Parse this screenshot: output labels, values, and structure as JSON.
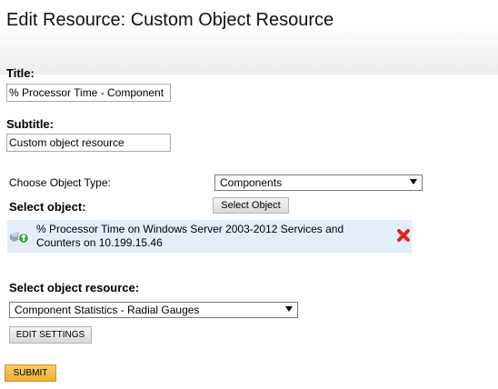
{
  "page": {
    "title": "Edit Resource: Custom Object Resource"
  },
  "form": {
    "title_label": "Title:",
    "title_value": "% Processor Time - Component",
    "subtitle_label": "Subtitle:",
    "subtitle_value": "Custom object resource",
    "object_type_label": "Choose Object Type:",
    "object_type_value": "Components",
    "select_object_label": "Select object:",
    "select_object_button": "Select Object",
    "selected_object": {
      "name": "% Processor Time on Windows Server 2003-2012 Services and Counters on 10.199.15.46",
      "icon": "component-status-up-icon",
      "remove_icon": "red-x-remove-icon"
    },
    "object_resource_label": "Select object resource:",
    "object_resource_value": "Component Statistics - Radial Gauges",
    "edit_settings_button": "EDIT SETTINGS",
    "submit_button": "SUBMIT"
  },
  "colors": {
    "selected_row_bg": "#e3eef8",
    "submit_bg": "#f2b843",
    "remove_red": "#d9261c",
    "status_green": "#3aa63a"
  }
}
